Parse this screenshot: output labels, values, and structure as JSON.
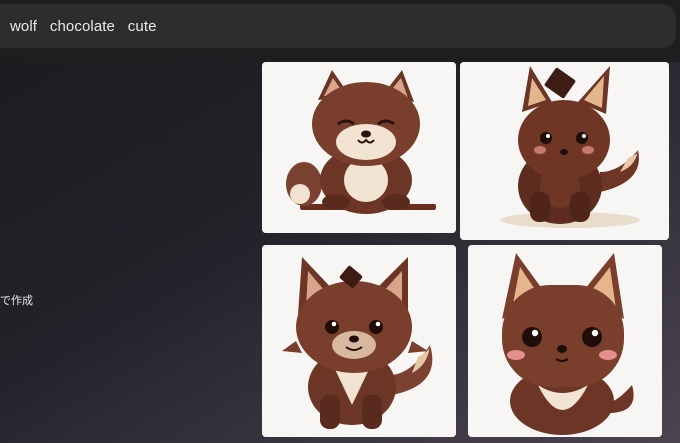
{
  "prompt": {
    "text": "wolf   chocolate   cute"
  },
  "side_label": "で作成",
  "images": [
    {
      "name": "wolf-image-1",
      "icon": "chocolate-wolf-smiling"
    },
    {
      "name": "wolf-image-2",
      "icon": "chocolate-wolf-sitting"
    },
    {
      "name": "wolf-image-3",
      "icon": "chocolate-wolf-fluffy"
    },
    {
      "name": "wolf-image-4",
      "icon": "chocolate-wolf-blush"
    }
  ],
  "colors": {
    "topbar": "#1e1e20",
    "prompt_box": "#2d2d30",
    "fur_dark": "#5a2e22",
    "fur_mid": "#7a4030",
    "cream": "#f3e3d2"
  }
}
